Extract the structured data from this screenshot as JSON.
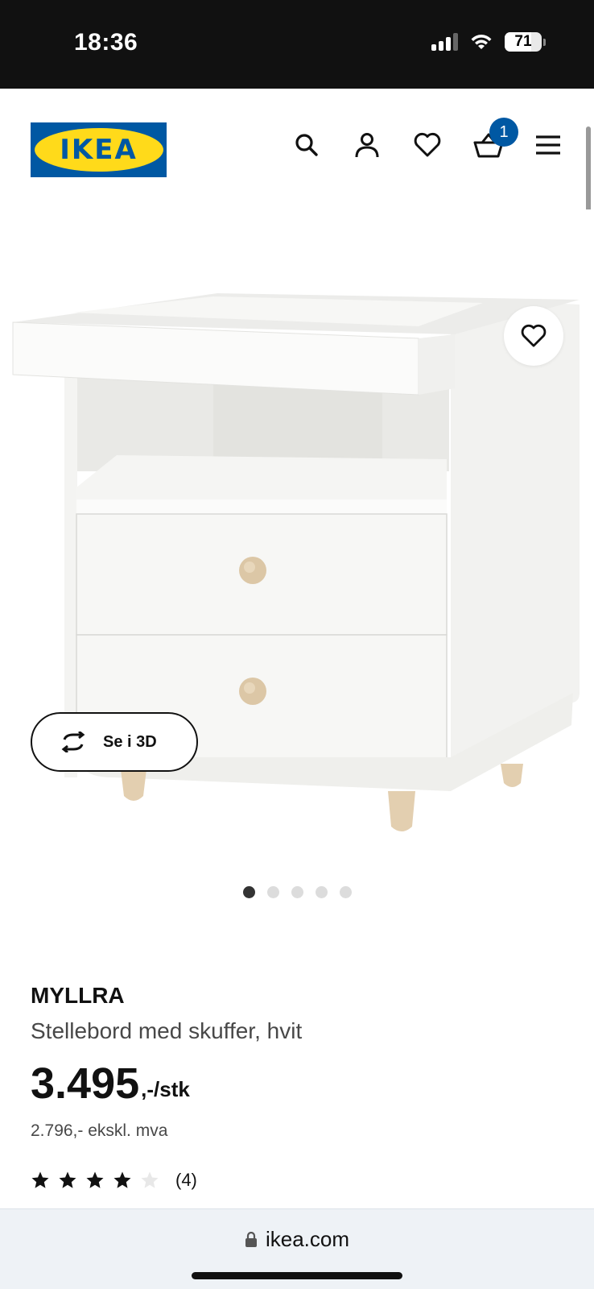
{
  "status_bar": {
    "time": "18:36",
    "battery": "71",
    "icons": [
      "signal-icon",
      "wifi-icon",
      "battery-icon"
    ]
  },
  "header": {
    "logo_text": "IKEA",
    "icons": [
      "search-icon",
      "account-icon",
      "heart-icon",
      "cart-icon",
      "menu-icon"
    ],
    "cart_count": "1"
  },
  "gallery": {
    "image": "product-photo",
    "view_3d_label": "Se i 3D",
    "dot_count": 5,
    "active_index": 0
  },
  "product": {
    "name": "MYLLRA",
    "description": "Stellebord med skuffer, hvit",
    "price": "3.495",
    "price_suffix": ",-/stk",
    "price_ex_vat": "2.796,- ekskl. mva",
    "rating_stars": 4,
    "rating_max": 5,
    "review_count": "(4)"
  },
  "browser": {
    "url": "ikea.com"
  },
  "colors": {
    "ikea_blue": "#0058a3",
    "ikea_yellow": "#ffda1a",
    "text": "#111111",
    "muted": "#484848"
  }
}
